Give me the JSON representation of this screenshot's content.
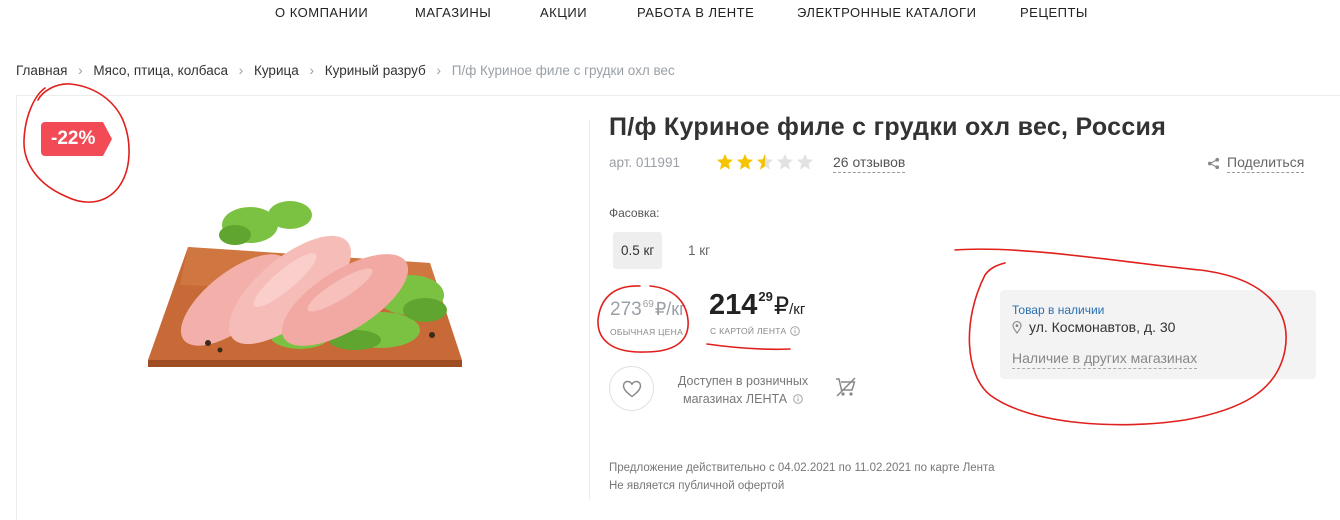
{
  "nav": [
    "О КОМПАНИИ",
    "МАГАЗИНЫ",
    "АКЦИИ",
    "РАБОТА В ЛЕНТЕ",
    "ЭЛЕКТРОННЫЕ КАТАЛОГИ",
    "РЕЦЕПТЫ"
  ],
  "breadcrumb": [
    "Главная",
    "Мясо, птица, колбаса",
    "Курица",
    "Куриный разруб",
    "П/ф Куриное филе с грудки охл вес"
  ],
  "discount": "-22%",
  "product": {
    "title": "П/ф Куриное филе с грудки охл вес, Россия",
    "article": "арт. 011991",
    "rating": 2.5,
    "rating_max": 5,
    "reviews": "26 отзывов",
    "share": "Поделиться"
  },
  "packing": {
    "label": "Фасовка:",
    "options": [
      "0.5 кг",
      "1 кг"
    ],
    "selected": "0.5 кг"
  },
  "prices": {
    "old_int": "273",
    "old_frac": "69",
    "old_unit": "₽/кг",
    "old_caption": "ОБЫЧНАЯ ЦЕНА",
    "new_int": "214",
    "new_frac": "29",
    "new_currency": "₽",
    "new_per": "/кг",
    "new_caption": "С КАРТОЙ ЛЕНТА"
  },
  "availability": {
    "line1": "Доступен в розничных",
    "line2": "магазинах ЛЕНТА"
  },
  "stock": {
    "status": "Товар в наличии",
    "address": "ул. Космонавтов, д. 30",
    "other": "Наличие в других магазинах"
  },
  "offer": {
    "line1": "Предложение действительно с 04.02.2021 по 11.02.2021 по карте Лента",
    "line2": "Не является публичной офертой"
  },
  "colors": {
    "discount": "#f24b55",
    "star_filled": "#f5c400",
    "star_empty": "#e2e2e2",
    "stock_status": "#2a6fb0",
    "annotation": "#e0201c"
  },
  "icons": [
    "star-icon",
    "share-icon",
    "info-icon",
    "heart-icon",
    "cart-disabled-icon",
    "location-pin-icon"
  ]
}
